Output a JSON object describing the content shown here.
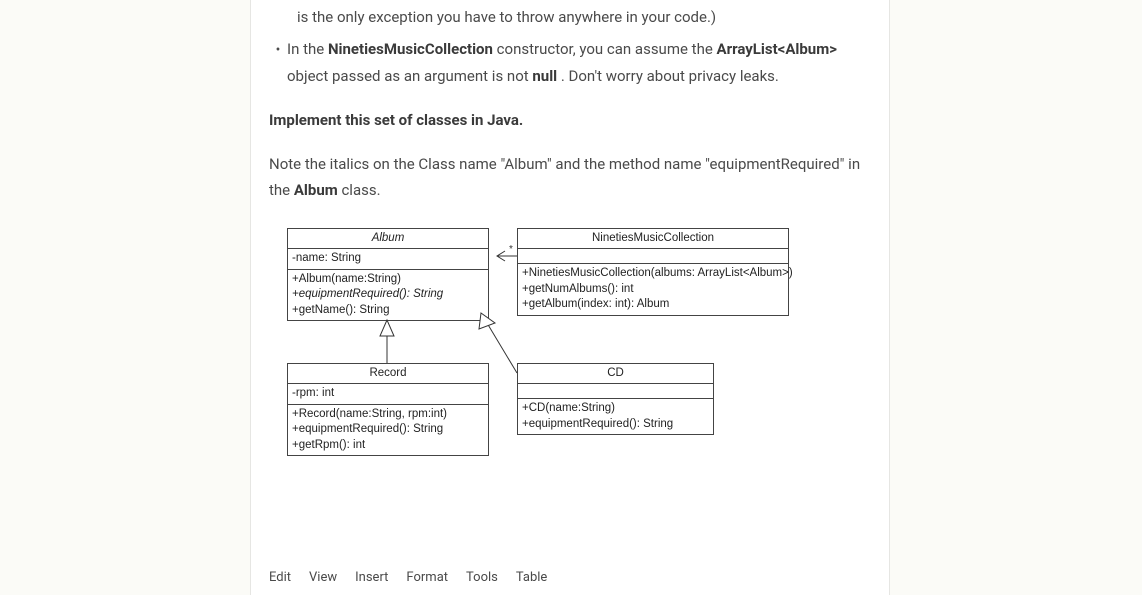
{
  "intro": {
    "line1": "is the only exception you have to throw anywhere in your code.)",
    "bullet_pre": "In the ",
    "bullet_class": "NinetiesMusicCollection",
    "bullet_mid": " constructor, you can assume the ",
    "bullet_type": "ArrayList<Album>",
    "bullet_post1": " object passed as an argument is not ",
    "bullet_null": "null",
    "bullet_post2": " . Don't worry about privacy leaks."
  },
  "implement": "Implement this set of classes in Java.",
  "note_pre": "Note the italics on the Class name \"Album\" and the method name \"equipmentRequired\" in the ",
  "note_class": "Album",
  "note_post": " class.",
  "uml": {
    "album": {
      "title": "Album",
      "attrs": [
        "-name: String"
      ],
      "ops": [
        "+Album(name:String)",
        "+equipmentRequired(): String",
        "+getName(): String"
      ],
      "abstract_title": true,
      "abstract_op_idx": 1
    },
    "collection": {
      "title": "NinetiesMusicCollection",
      "attrs": [],
      "ops": [
        "+NinetiesMusicCollection(albums: ArrayList<Album>)",
        "+getNumAlbums(): int",
        "+getAlbum(index: int): Album"
      ]
    },
    "record": {
      "title": "Record",
      "attrs": [
        "-rpm: int"
      ],
      "ops": [
        "+Record(name:String, rpm:int)",
        "+equipmentRequired(): String",
        "+getRpm(): int"
      ]
    },
    "cd": {
      "title": "CD",
      "attrs": [],
      "ops": [
        "+CD(name:String)",
        "+equipmentRequired(): String"
      ]
    }
  },
  "toolbar": {
    "edit": "Edit",
    "view": "View",
    "insert": "Insert",
    "format": "Format",
    "tools": "Tools",
    "table": "Table"
  }
}
